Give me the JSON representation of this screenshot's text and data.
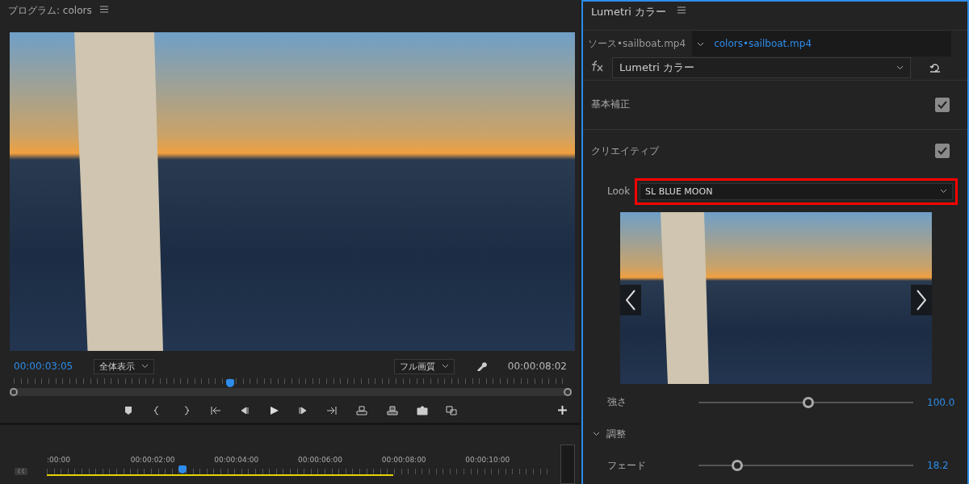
{
  "program_monitor": {
    "title": "プログラム: colors",
    "timecode": "00:00:03:05",
    "zoom": "全体表示",
    "quality": "フル画質",
    "duration": "00:00:08:02",
    "scrubber": {
      "level": 0.39
    }
  },
  "timeline": {
    "ruler": [
      ":00:00",
      "00:00:02:00",
      "00:00:04:00",
      "00:00:06:00",
      "00:00:08:00",
      "00:00:10:00"
    ],
    "playhead": {
      "level": 0.27
    },
    "work_area": {
      "level": 0.69
    }
  },
  "lumetri": {
    "title": "Lumetri カラー",
    "tabs": [
      {
        "label": "ソース•sailboat.mp4",
        "selected": false
      },
      {
        "label": "colors•sailboat.mp4",
        "selected": true
      }
    ],
    "effect": "Lumetri カラー",
    "sections": [
      {
        "label": "基本補正",
        "checked": true
      },
      {
        "label": "クリエイティブ",
        "checked": true
      }
    ],
    "look": {
      "label": "Look",
      "value": "SL BLUE MOON",
      "highlighted": true
    },
    "intensity": {
      "label": "強さ",
      "level": 0.51,
      "reading": "100.0"
    },
    "adjust": {
      "label": "調整",
      "expanded": true
    },
    "fade": {
      "label": "フェード",
      "level": 0.18,
      "reading": "18.2"
    }
  }
}
